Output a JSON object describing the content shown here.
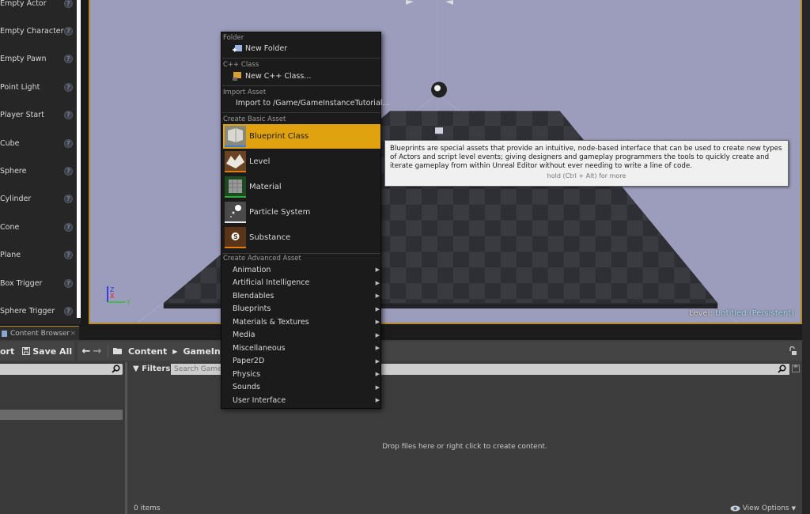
{
  "place_panel": {
    "items": [
      {
        "label": "Empty Actor"
      },
      {
        "label": "Empty Character"
      },
      {
        "label": "Empty Pawn"
      },
      {
        "label": "Point Light"
      },
      {
        "label": "Player Start"
      },
      {
        "label": "Cube"
      },
      {
        "label": "Sphere"
      },
      {
        "label": "Cylinder"
      },
      {
        "label": "Cone"
      },
      {
        "label": "Plane"
      },
      {
        "label": "Box Trigger"
      },
      {
        "label": "Sphere Trigger"
      }
    ],
    "help_glyph": "?"
  },
  "viewport": {
    "level_label": "Level:",
    "level_name": "Untitled (Persistent)",
    "axis_labels": {
      "z": "Z",
      "x": "X",
      "y": "Y"
    }
  },
  "context_menu": {
    "sections": {
      "folder": "Folder",
      "cpp": "C++ Class",
      "import": "Import Asset",
      "basic": "Create Basic Asset",
      "advanced": "Create Advanced Asset"
    },
    "new_folder": "New Folder",
    "new_cpp_class": "New C++ Class...",
    "import_to": "Import to /Game/GameInstanceTutorial...",
    "basic_assets": [
      {
        "label": "Blueprint Class",
        "accent": "#3d7be0",
        "selected": true
      },
      {
        "label": "Level",
        "accent": "#e07b10",
        "selected": false
      },
      {
        "label": "Material",
        "accent": "#2fa83a",
        "selected": false
      },
      {
        "label": "Particle System",
        "accent": "#e8e8e8",
        "selected": false
      },
      {
        "label": "Substance",
        "accent": "#e07b10",
        "selected": false
      }
    ],
    "advanced_assets": [
      {
        "label": "Animation"
      },
      {
        "label": "Artificial Intelligence"
      },
      {
        "label": "Blendables"
      },
      {
        "label": "Blueprints"
      },
      {
        "label": "Materials & Textures"
      },
      {
        "label": "Media"
      },
      {
        "label": "Miscellaneous"
      },
      {
        "label": "Paper2D"
      },
      {
        "label": "Physics"
      },
      {
        "label": "Sounds"
      },
      {
        "label": "User Interface"
      }
    ],
    "submenu_arrow": "▶"
  },
  "tooltip": {
    "body": "Blueprints are special assets that provide an intuitive, node-based interface that can be used to create new types of Actors and script level events; giving designers and gameplay programmers the tools to quickly create and iterate gameplay from within Unreal Editor without ever needing to write a line of code.",
    "hint": "hold (Ctrl + Alt) for more"
  },
  "content_browser": {
    "tab_label": "Content Browser",
    "tab_close": "×",
    "import_label": "ort",
    "save_all_label": "Save All",
    "back_glyph": "🡐",
    "forward_glyph": "🡒",
    "breadcrumb": [
      "Content",
      "GameInsta"
    ],
    "breadcrumb_sep": "▶",
    "filters_label": "Filters",
    "search_placeholder": "Search GameIn",
    "empty_message": "Drop files here or right click to create content.",
    "item_count": "0 items",
    "view_options_label": "View Options"
  },
  "colors": {
    "accent_selected": "#e0a20e",
    "viewport_border": "#b7892c",
    "level_name": "#9fdcef"
  }
}
